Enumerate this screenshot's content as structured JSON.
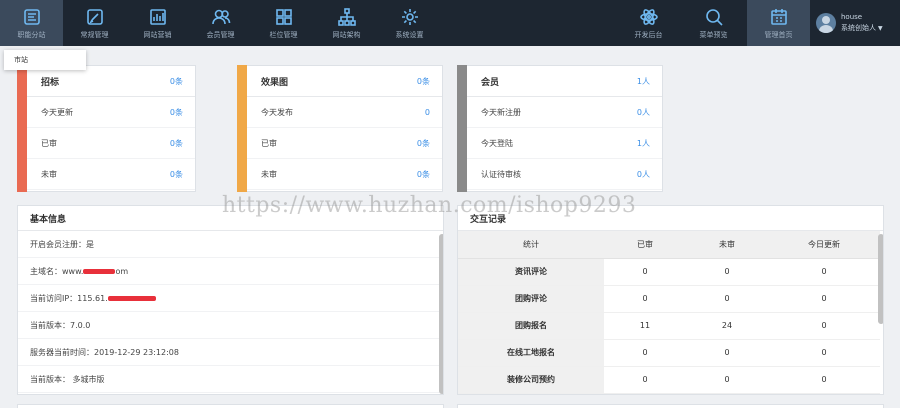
{
  "nav": {
    "items": [
      {
        "label": "职能分站",
        "icon": "category-icon",
        "active": true
      },
      {
        "label": "常规管理",
        "icon": "edit-icon",
        "active": false
      },
      {
        "label": "网站营销",
        "icon": "chart-icon",
        "active": false
      },
      {
        "label": "会员管理",
        "icon": "users-icon",
        "active": false
      },
      {
        "label": "栏位管理",
        "icon": "grid-icon",
        "active": false
      },
      {
        "label": "网站架构",
        "icon": "sitemap-icon",
        "active": false
      },
      {
        "label": "系统设置",
        "icon": "gear-icon",
        "active": false
      }
    ],
    "right_items": [
      {
        "label": "开发后台",
        "icon": "atom-icon"
      },
      {
        "label": "菜单预览",
        "icon": "search-icon"
      },
      {
        "label": "管理首页",
        "icon": "calendar-icon",
        "active": true
      }
    ],
    "user": {
      "name": "house",
      "role": "系统创始人"
    }
  },
  "dropdown": {
    "item": "市站"
  },
  "cards": [
    {
      "title": "招标",
      "title_value": "0条",
      "color": "#e96a52",
      "rows": [
        {
          "k": "今天更新",
          "v": "0条"
        },
        {
          "k": "已审",
          "v": "0条"
        },
        {
          "k": "未审",
          "v": "0条"
        }
      ]
    },
    {
      "title": "效果图",
      "title_value": "0条",
      "color": "#f0a847",
      "rows": [
        {
          "k": "今天发布",
          "v": "0"
        },
        {
          "k": "已审",
          "v": "0条"
        },
        {
          "k": "未审",
          "v": "0条"
        }
      ]
    },
    {
      "title": "会员",
      "title_value": "1人",
      "color": "#8a8a8a",
      "rows": [
        {
          "k": "今天新注册",
          "v": "0人"
        },
        {
          "k": "今天登陆",
          "v": "1人"
        },
        {
          "k": "认证待审核",
          "v": "0人"
        }
      ]
    }
  ],
  "basic_info": {
    "title": "基本信息",
    "rows": [
      "开启会员注册：是",
      "主域名：www.",
      "当前访问IP：115.61.",
      "当前版本：7.0.0",
      "服务器当前时间：2019-12-29 23:12:08",
      "当前版本： 多城市版"
    ],
    "row2_tail": "om"
  },
  "interaction": {
    "title": "交互记录",
    "headers": [
      "统计",
      "已审",
      "未审",
      "今日更新"
    ],
    "rows": [
      [
        "资讯评论",
        "0",
        "0",
        "0"
      ],
      [
        "团购评论",
        "0",
        "0",
        "0"
      ],
      [
        "团购报名",
        "11",
        "24",
        "0"
      ],
      [
        "在线工地报名",
        "0",
        "0",
        "0"
      ],
      [
        "装修公司预约",
        "0",
        "0",
        "0"
      ]
    ]
  },
  "watermark": "https://www.huzhan.com/ishop9293"
}
